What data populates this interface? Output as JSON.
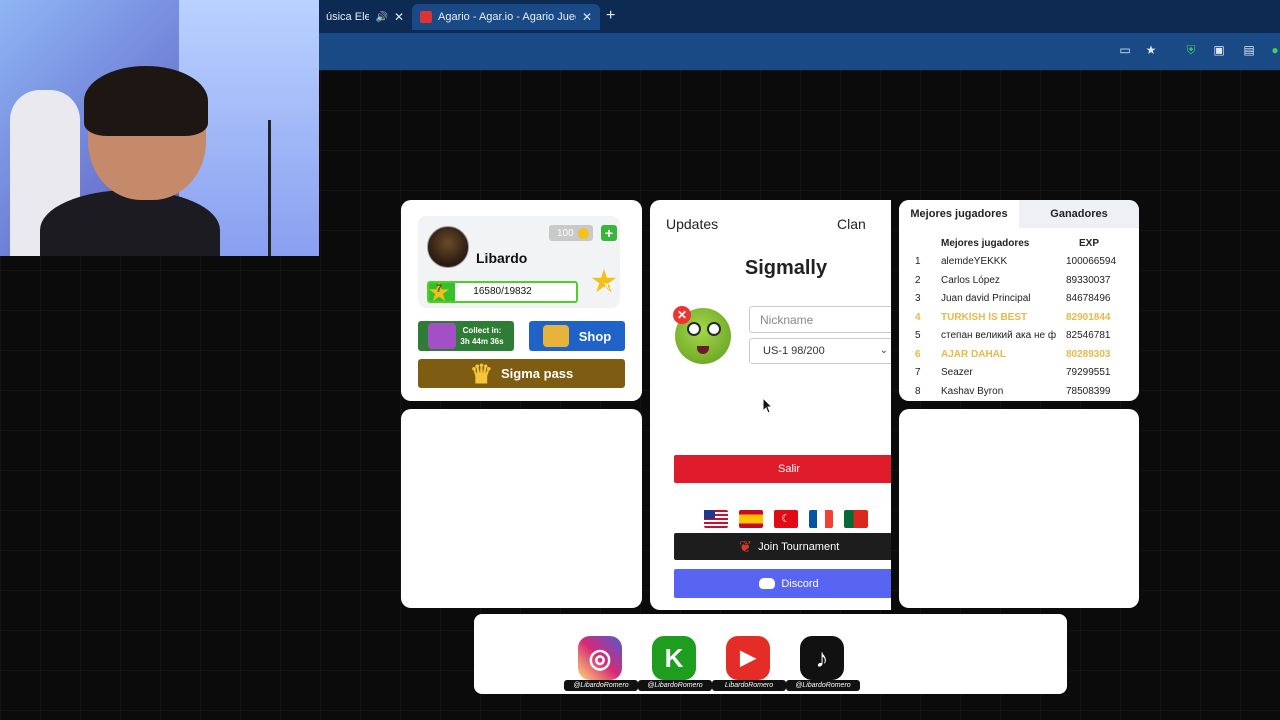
{
  "browser": {
    "tabs": [
      {
        "title": "úsica Electr",
        "active": false
      },
      {
        "title": "Agario - Agar.io - Agario Juegos",
        "active": true
      }
    ],
    "new_tab": "+",
    "close": "✕"
  },
  "profile": {
    "username": "Libardo",
    "coins": "100",
    "add": "+",
    "level": "7",
    "xp_text": "16580/19832",
    "xp_current": 16580,
    "xp_max": 19832,
    "xp_badge": "XP",
    "collect_line1": "Collect in:",
    "collect_line2": "3h 44m 36s",
    "shop_label": "Shop",
    "sigma_pass_label": "Sigma pass"
  },
  "center": {
    "tab_updates": "Updates",
    "tab_clan": "Clan",
    "title": "Sigmally",
    "remove_skin": "✕",
    "nickname_placeholder": "Nickname",
    "server": "US-1 98/200",
    "exit_label": "Salir",
    "flags": [
      "us-flag",
      "es-flag",
      "tr-flag",
      "fr-flag",
      "pt-flag"
    ],
    "join_tournament": "Join Tournament",
    "discord": "Discord"
  },
  "leaderboard": {
    "tab_best": "Mejores jugadores",
    "tab_winners": "Ganadores",
    "col_player": "Mejores jugadores",
    "col_exp": "EXP",
    "rows": [
      {
        "rank": "1",
        "name": "alemdeYEKKK",
        "exp": "100066594",
        "highlight": false
      },
      {
        "rank": "2",
        "name": "Carlos López",
        "exp": "89330037",
        "highlight": false
      },
      {
        "rank": "3",
        "name": "Juan david Principal",
        "exp": "84678496",
        "highlight": false
      },
      {
        "rank": "4",
        "name": "TURKİSH İS BEST",
        "exp": "82901844",
        "highlight": true
      },
      {
        "rank": "5",
        "name": "степан великий ака не ф",
        "exp": "82546781",
        "highlight": false
      },
      {
        "rank": "6",
        "name": "AJAR DAHAL",
        "exp": "80289303",
        "highlight": true
      },
      {
        "rank": "7",
        "name": "Seazer",
        "exp": "79299551",
        "highlight": false
      },
      {
        "rank": "8",
        "name": "Kashav Byron",
        "exp": "78508399",
        "highlight": false
      }
    ],
    "highlight_color": "#e8b84a"
  },
  "social": [
    {
      "icon": "instagram-icon",
      "handle": "@LibardoRomero",
      "color": "#d62976"
    },
    {
      "icon": "kick-icon",
      "handle": "@LibardoRomero",
      "color": "#1e9e1e"
    },
    {
      "icon": "youtube-icon",
      "handle": "LibardoRomero",
      "color": "#e52d27"
    },
    {
      "icon": "tiktok-icon",
      "handle": "@LibardoRomero",
      "color": "#111111"
    }
  ]
}
